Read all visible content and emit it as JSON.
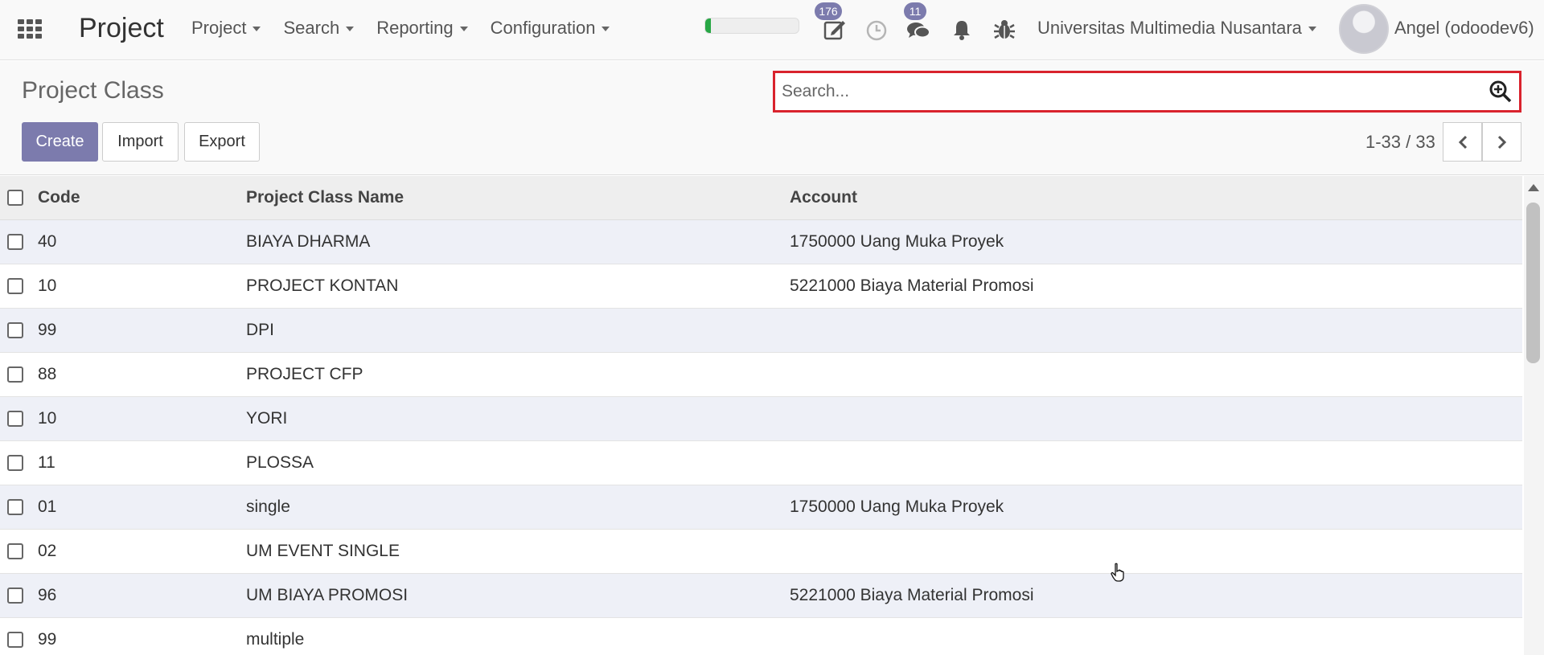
{
  "navbar": {
    "app_title": "Project",
    "menu": [
      {
        "label": "Project"
      },
      {
        "label": "Search"
      },
      {
        "label": "Reporting"
      },
      {
        "label": "Configuration"
      }
    ],
    "activity_badge": "176",
    "messages_badge": "11",
    "progress_fraction": 0.06,
    "company": "Universitas Multimedia Nusantara",
    "user": "Angel (odoodev6)"
  },
  "control": {
    "page_title": "Project Class",
    "create_label": "Create",
    "import_label": "Import",
    "export_label": "Export",
    "search_placeholder": "Search...",
    "pager": "1-33 / 33"
  },
  "table": {
    "headers": {
      "code": "Code",
      "name": "Project Class Name",
      "account": "Account"
    },
    "rows": [
      {
        "code": "40",
        "name": "BIAYA DHARMA",
        "account": "1750000 Uang Muka Proyek"
      },
      {
        "code": "10",
        "name": "PROJECT KONTAN",
        "account": "5221000 Biaya Material Promosi"
      },
      {
        "code": "99",
        "name": "DPI",
        "account": ""
      },
      {
        "code": "88",
        "name": "PROJECT CFP",
        "account": ""
      },
      {
        "code": "10",
        "name": "YORI",
        "account": ""
      },
      {
        "code": "11",
        "name": "PLOSSA",
        "account": ""
      },
      {
        "code": "01",
        "name": "single",
        "account": "1750000 Uang Muka Proyek"
      },
      {
        "code": "02",
        "name": "UM EVENT SINGLE",
        "account": ""
      },
      {
        "code": "96",
        "name": "UM BIAYA PROMOSI",
        "account": "5221000 Biaya Material Promosi"
      },
      {
        "code": "99",
        "name": "multiple",
        "account": ""
      }
    ]
  },
  "colors": {
    "accent": "#7c7bad",
    "highlight": "#d9232d",
    "row_stripe": "#eef0f7"
  }
}
